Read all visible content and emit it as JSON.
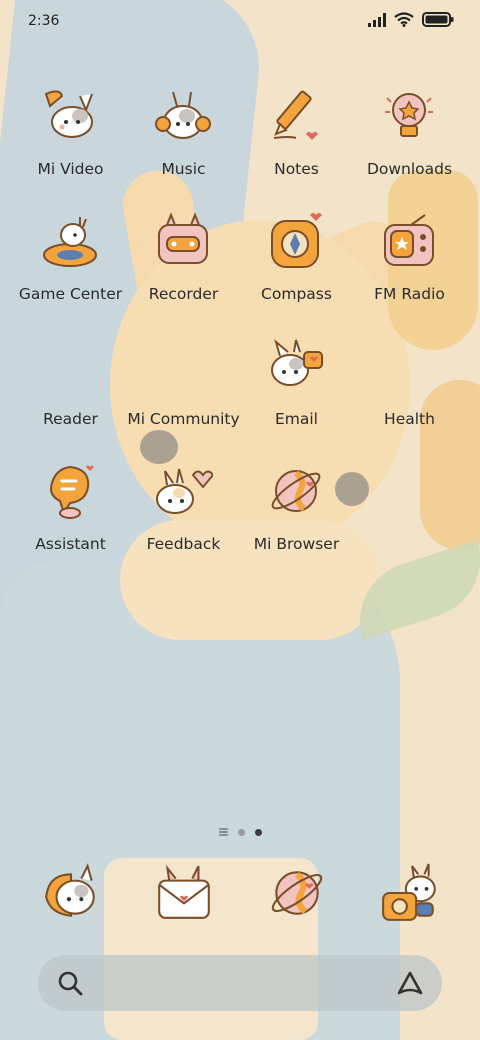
{
  "status": {
    "time": "2:36"
  },
  "apps": [
    [
      {
        "label": "Mi Video",
        "icon": "bunny-play-icon"
      },
      {
        "label": "Music",
        "icon": "bunny-headphones-icon"
      },
      {
        "label": "Notes",
        "icon": "pencil-icon"
      },
      {
        "label": "Downloads",
        "icon": "lightbulb-icon"
      }
    ],
    [
      {
        "label": "Game Center",
        "icon": "bunny-ring-icon"
      },
      {
        "label": "Recorder",
        "icon": "cassette-icon"
      },
      {
        "label": "Compass",
        "icon": "compass-icon"
      },
      {
        "label": "FM Radio",
        "icon": "radio-icon"
      }
    ],
    [
      {
        "label": "Reader",
        "icon": "reader-icon"
      },
      {
        "label": "Mi Community",
        "icon": "community-icon"
      },
      {
        "label": "Email",
        "icon": "bunny-mail-icon"
      },
      {
        "label": "Health",
        "icon": "health-icon"
      }
    ],
    [
      {
        "label": "Assistant",
        "icon": "chat-bubble-icon"
      },
      {
        "label": "Feedback",
        "icon": "bunny-heart-icon"
      },
      {
        "label": "Mi Browser",
        "icon": "planet-icon"
      }
    ]
  ],
  "dock": [
    {
      "icon": "bunny-phone-icon"
    },
    {
      "icon": "bunny-envelope-icon"
    },
    {
      "icon": "planet-heart-icon"
    },
    {
      "icon": "bunny-camera-icon"
    }
  ],
  "colors": {
    "accent": "#f0a23a",
    "outline": "#7a4e2a",
    "pink": "#f2b8b0"
  }
}
